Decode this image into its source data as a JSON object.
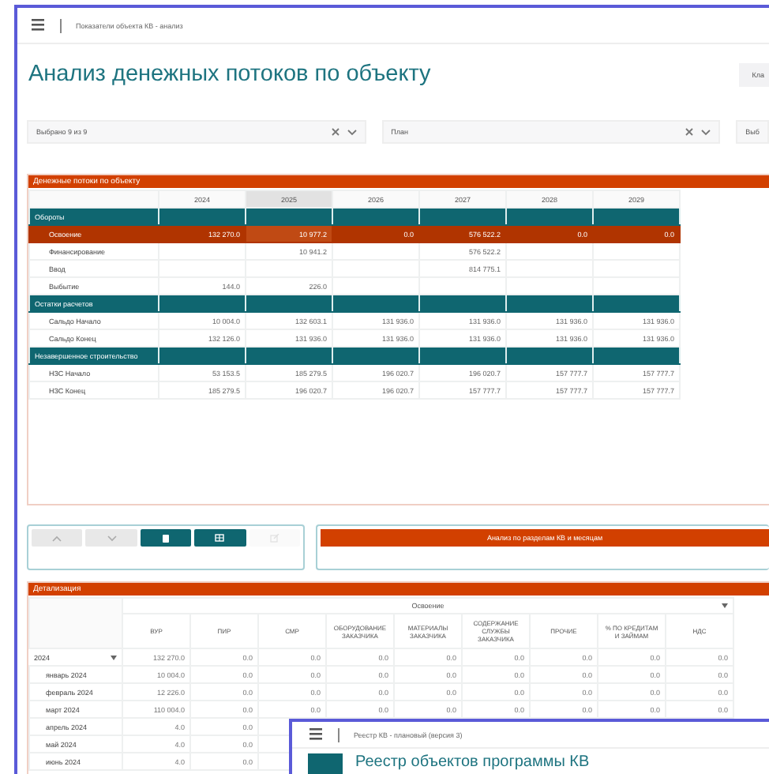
{
  "header": {
    "breadcrumb": "Показатели объекта КВ - анализ"
  },
  "title": "Анализ денежных потоков по объекту",
  "top_button": "Кла",
  "filters": [
    {
      "value": "Выбрано 9 из 9",
      "clearable": true
    },
    {
      "value": "План",
      "clearable": true
    },
    {
      "value": "Выб",
      "clearable": false
    }
  ],
  "cashflow": {
    "title": "Денежные потоки по объекту",
    "columns": [
      {
        "label": "2024",
        "selected": false
      },
      {
        "label": "2025",
        "selected": true
      },
      {
        "label": "2026",
        "selected": false
      },
      {
        "label": "2027",
        "selected": false
      },
      {
        "label": "2028",
        "selected": false
      },
      {
        "label": "2029",
        "selected": false
      }
    ],
    "rows": [
      {
        "kind": "group",
        "label": "Обороты"
      },
      {
        "kind": "data",
        "label": "Освоение",
        "selected": true,
        "cells": [
          "132 270.0",
          "10 977.2",
          "0.0",
          "576 522.2",
          "0.0",
          "0.0"
        ]
      },
      {
        "kind": "data",
        "label": "Финансирование",
        "selected": false,
        "cells": [
          "",
          "10 941.2",
          "",
          "576 522.2",
          "",
          ""
        ]
      },
      {
        "kind": "data",
        "label": "Ввод",
        "selected": false,
        "cells": [
          "",
          "",
          "",
          "814 775.1",
          "",
          ""
        ]
      },
      {
        "kind": "data",
        "label": "Выбытие",
        "selected": false,
        "cells": [
          "144.0",
          "226.0",
          "",
          "",
          "",
          ""
        ]
      },
      {
        "kind": "group",
        "label": "Остатки расчетов"
      },
      {
        "kind": "data",
        "label": "Сальдо Начало",
        "selected": false,
        "cells": [
          "10 004.0",
          "132 603.1",
          "131 936.0",
          "131 936.0",
          "131 936.0",
          "131 936.0"
        ]
      },
      {
        "kind": "data",
        "label": "Сальдо Конец",
        "selected": false,
        "cells": [
          "132 126.0",
          "131 936.0",
          "131 936.0",
          "131 936.0",
          "131 936.0",
          "131 936.0"
        ]
      },
      {
        "kind": "group",
        "label": "Незавершенное строительство"
      },
      {
        "kind": "data",
        "label": "НЗС Начало",
        "selected": false,
        "cells": [
          "53 153.5",
          "185 279.5",
          "196 020.7",
          "196 020.7",
          "157 777.7",
          "157 777.7"
        ]
      },
      {
        "kind": "data",
        "label": "НЗС Конец",
        "selected": false,
        "cells": [
          "185 279.5",
          "196 020.7",
          "196 020.7",
          "157 777.7",
          "157 777.7",
          "157 777.7"
        ]
      }
    ]
  },
  "toolbar": [
    {
      "kind": "up",
      "disabled": false,
      "primary": false
    },
    {
      "kind": "down",
      "disabled": false,
      "primary": false
    },
    {
      "kind": "delete",
      "disabled": false,
      "primary": true
    },
    {
      "kind": "table",
      "disabled": false,
      "primary": true
    },
    {
      "kind": "edit",
      "disabled": true,
      "primary": false
    }
  ],
  "analysis_button": "Анализ по разделам КВ и месяцам",
  "detail": {
    "title": "Детализация",
    "group": "Освоение",
    "columns": [
      "ВУР",
      "ПИР",
      "СМР",
      "ОБОРУДОВАНИЕ ЗАКАЗЧИКА",
      "МАТЕРИАЛЫ ЗАКАЗЧИКА",
      "СОДЕРЖАНИЕ СЛУЖБЫ ЗАКАЗЧИКА",
      "ПРОЧИЕ",
      "% ПО КРЕДИТАМ И ЗАЙМАМ",
      "НДС"
    ],
    "rows": [
      {
        "label": "2024",
        "expanded": true,
        "cells": [
          "132 270.0",
          "0.0",
          "0.0",
          "0.0",
          "0.0",
          "0.0",
          "0.0",
          "0.0",
          "0.0"
        ]
      },
      {
        "label": "январь 2024",
        "cells": [
          "10 004.0",
          "0.0",
          "0.0",
          "0.0",
          "0.0",
          "0.0",
          "0.0",
          "0.0",
          "0.0"
        ]
      },
      {
        "label": "февраль 2024",
        "cells": [
          "12 226.0",
          "0.0",
          "0.0",
          "0.0",
          "0.0",
          "0.0",
          "0.0",
          "0.0",
          "0.0"
        ]
      },
      {
        "label": "март 2024",
        "cells": [
          "110 004.0",
          "0.0",
          "0.0",
          "0.0",
          "0.0",
          "0.0",
          "0.0",
          "0.0",
          "0.0"
        ]
      },
      {
        "label": "апрель 2024",
        "cells": [
          "4.0",
          "0.0"
        ]
      },
      {
        "label": "май 2024",
        "cells": [
          "4.0",
          "0.0"
        ]
      },
      {
        "label": "июнь 2024",
        "cells": [
          "4.0",
          "0.0"
        ]
      }
    ]
  },
  "overlay_window": {
    "breadcrumb": "Реестр КВ - плановый (версия 3)",
    "title": "Реестр объектов программы КВ"
  }
}
